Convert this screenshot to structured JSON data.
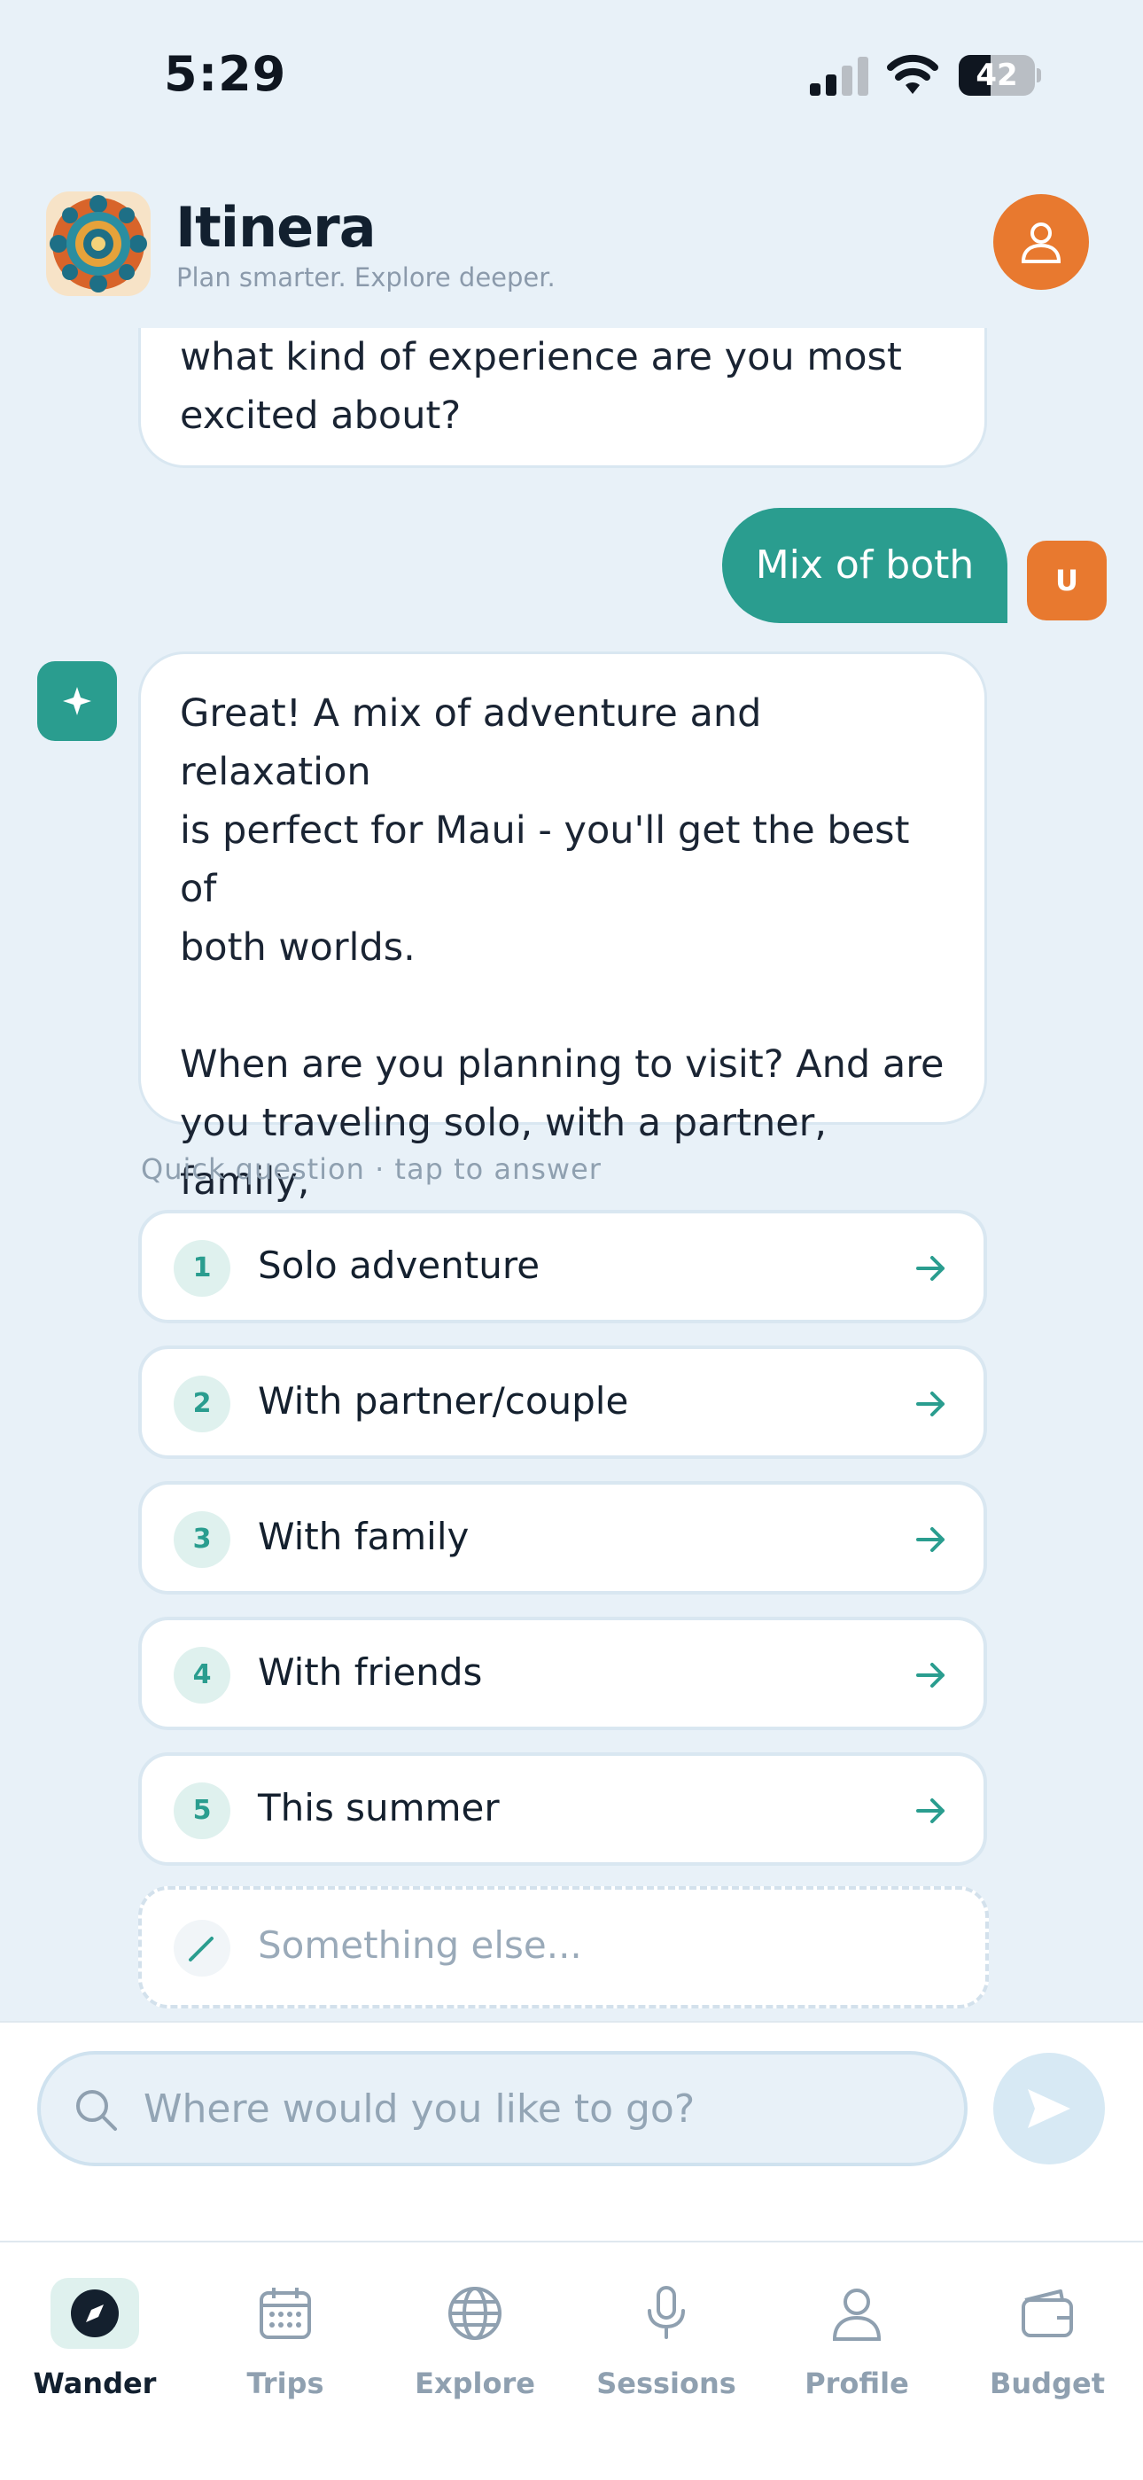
{
  "status": {
    "time": "5:29",
    "battery": "42",
    "battery_level": 0.42
  },
  "header": {
    "title": "Itinera",
    "subtitle": "Plan smarter. Explore deeper.",
    "logo_icon": "mandala-logo-icon",
    "account_icon": "person-icon"
  },
  "chat": {
    "ai_partial": "what kind of experience are you most\nexcited about?",
    "user_message": "Mix of both",
    "user_avatar": "U",
    "ai_message": "Great! A mix of adventure and relaxation\nis perfect for Maui - you'll get the best of\nboth worlds.\n\nWhen are you planning to visit? And are\nyou traveling solo, with a partner, family,\nor friends?",
    "quick_label": "Quick question · tap to answer",
    "options": [
      {
        "num": "1",
        "label": "Solo adventure"
      },
      {
        "num": "2",
        "label": "With partner/couple"
      },
      {
        "num": "3",
        "label": "With family"
      },
      {
        "num": "4",
        "label": "With friends"
      },
      {
        "num": "5",
        "label": "This summer"
      }
    ],
    "other_placeholder": "Something else..."
  },
  "composer": {
    "placeholder": "Where would you like to go?"
  },
  "tabs": [
    {
      "label": "Wander",
      "icon": "compass-icon",
      "active": true
    },
    {
      "label": "Trips",
      "icon": "calendar-icon",
      "active": false
    },
    {
      "label": "Explore",
      "icon": "globe-icon",
      "active": false
    },
    {
      "label": "Sessions",
      "icon": "microphone-icon",
      "active": false
    },
    {
      "label": "Profile",
      "icon": "person-icon",
      "active": false
    },
    {
      "label": "Budget",
      "icon": "wallet-icon",
      "active": false
    }
  ],
  "colors": {
    "accent": "#2a9d8f",
    "orange": "#e8792f",
    "background": "#e8f1f8"
  }
}
